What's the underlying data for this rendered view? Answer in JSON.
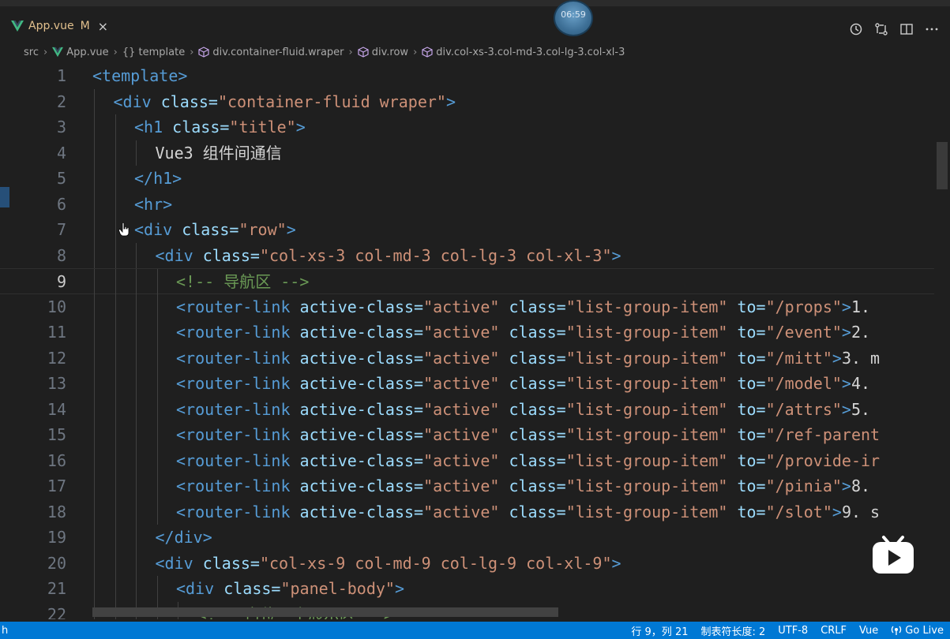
{
  "tab": {
    "filename": "App.vue",
    "modified": "M",
    "close": "×"
  },
  "timer_overlay": "06:59",
  "breadcrumbs": [
    {
      "label": "src"
    },
    {
      "label": "App.vue"
    },
    {
      "label": "{} template"
    },
    {
      "label": "div.container-fluid.wraper"
    },
    {
      "label": "div.row"
    },
    {
      "label": "div.col-xs-3.col-md-3.col-lg-3.col-xl-3"
    }
  ],
  "editor": {
    "current_line": 9,
    "lines": [
      {
        "n": "1",
        "indent": 0,
        "tokens": [
          [
            "tag",
            "<template>"
          ]
        ]
      },
      {
        "n": "2",
        "indent": 1,
        "tokens": [
          [
            "tag",
            "<div "
          ],
          [
            "attr",
            "class="
          ],
          [
            "str",
            "\"container-fluid wraper\""
          ],
          [
            "tag",
            ">"
          ]
        ]
      },
      {
        "n": "3",
        "indent": 2,
        "tokens": [
          [
            "tag",
            "<h1 "
          ],
          [
            "attr",
            "class="
          ],
          [
            "str",
            "\"title\""
          ],
          [
            "tag",
            ">"
          ]
        ]
      },
      {
        "n": "4",
        "indent": 3,
        "tokens": [
          [
            "text",
            "Vue3 组件间通信"
          ]
        ]
      },
      {
        "n": "5",
        "indent": 2,
        "tokens": [
          [
            "tag",
            "</h1>"
          ]
        ]
      },
      {
        "n": "6",
        "indent": 2,
        "tokens": [
          [
            "tag",
            "<hr>"
          ]
        ]
      },
      {
        "n": "7",
        "indent": 2,
        "tokens": [
          [
            "tag",
            "<div "
          ],
          [
            "attr",
            "class="
          ],
          [
            "str",
            "\"row\""
          ],
          [
            "tag",
            ">"
          ]
        ]
      },
      {
        "n": "8",
        "indent": 3,
        "tokens": [
          [
            "tag",
            "<div "
          ],
          [
            "attr",
            "class="
          ],
          [
            "str",
            "\"col-xs-3 col-md-3 col-lg-3 col-xl-3\""
          ],
          [
            "tag",
            ">"
          ]
        ]
      },
      {
        "n": "9",
        "indent": 4,
        "tokens": [
          [
            "com",
            "<!-- 导航区 -->"
          ]
        ]
      },
      {
        "n": "10",
        "indent": 4,
        "tokens": [
          [
            "tag",
            "<router-link "
          ],
          [
            "attr",
            "active-class="
          ],
          [
            "str",
            "\"active\" "
          ],
          [
            "attr",
            "class="
          ],
          [
            "str",
            "\"list-group-item\" "
          ],
          [
            "attr",
            "to="
          ],
          [
            "str",
            "\"/props\""
          ],
          [
            "tag",
            ">"
          ],
          [
            "text",
            "1."
          ]
        ]
      },
      {
        "n": "11",
        "indent": 4,
        "tokens": [
          [
            "tag",
            "<router-link "
          ],
          [
            "attr",
            "active-class="
          ],
          [
            "str",
            "\"active\" "
          ],
          [
            "attr",
            "class="
          ],
          [
            "str",
            "\"list-group-item\" "
          ],
          [
            "attr",
            "to="
          ],
          [
            "str",
            "\"/event\""
          ],
          [
            "tag",
            ">"
          ],
          [
            "text",
            "2."
          ]
        ]
      },
      {
        "n": "12",
        "indent": 4,
        "tokens": [
          [
            "tag",
            "<router-link "
          ],
          [
            "attr",
            "active-class="
          ],
          [
            "str",
            "\"active\" "
          ],
          [
            "attr",
            "class="
          ],
          [
            "str",
            "\"list-group-item\" "
          ],
          [
            "attr",
            "to="
          ],
          [
            "str",
            "\"/mitt\""
          ],
          [
            "tag",
            ">"
          ],
          [
            "text",
            "3. m"
          ]
        ]
      },
      {
        "n": "13",
        "indent": 4,
        "tokens": [
          [
            "tag",
            "<router-link "
          ],
          [
            "attr",
            "active-class="
          ],
          [
            "str",
            "\"active\" "
          ],
          [
            "attr",
            "class="
          ],
          [
            "str",
            "\"list-group-item\" "
          ],
          [
            "attr",
            "to="
          ],
          [
            "str",
            "\"/model\""
          ],
          [
            "tag",
            ">"
          ],
          [
            "text",
            "4."
          ]
        ]
      },
      {
        "n": "14",
        "indent": 4,
        "tokens": [
          [
            "tag",
            "<router-link "
          ],
          [
            "attr",
            "active-class="
          ],
          [
            "str",
            "\"active\" "
          ],
          [
            "attr",
            "class="
          ],
          [
            "str",
            "\"list-group-item\" "
          ],
          [
            "attr",
            "to="
          ],
          [
            "str",
            "\"/attrs\""
          ],
          [
            "tag",
            ">"
          ],
          [
            "text",
            "5."
          ]
        ]
      },
      {
        "n": "15",
        "indent": 4,
        "tokens": [
          [
            "tag",
            "<router-link "
          ],
          [
            "attr",
            "active-class="
          ],
          [
            "str",
            "\"active\" "
          ],
          [
            "attr",
            "class="
          ],
          [
            "str",
            "\"list-group-item\" "
          ],
          [
            "attr",
            "to="
          ],
          [
            "str",
            "\"/ref-parent"
          ]
        ]
      },
      {
        "n": "16",
        "indent": 4,
        "tokens": [
          [
            "tag",
            "<router-link "
          ],
          [
            "attr",
            "active-class="
          ],
          [
            "str",
            "\"active\" "
          ],
          [
            "attr",
            "class="
          ],
          [
            "str",
            "\"list-group-item\" "
          ],
          [
            "attr",
            "to="
          ],
          [
            "str",
            "\"/provide-ir"
          ]
        ]
      },
      {
        "n": "17",
        "indent": 4,
        "tokens": [
          [
            "tag",
            "<router-link "
          ],
          [
            "attr",
            "active-class="
          ],
          [
            "str",
            "\"active\" "
          ],
          [
            "attr",
            "class="
          ],
          [
            "str",
            "\"list-group-item\" "
          ],
          [
            "attr",
            "to="
          ],
          [
            "str",
            "\"/pinia\""
          ],
          [
            "tag",
            ">"
          ],
          [
            "text",
            "8."
          ]
        ]
      },
      {
        "n": "18",
        "indent": 4,
        "tokens": [
          [
            "tag",
            "<router-link "
          ],
          [
            "attr",
            "active-class="
          ],
          [
            "str",
            "\"active\" "
          ],
          [
            "attr",
            "class="
          ],
          [
            "str",
            "\"list-group-item\" "
          ],
          [
            "attr",
            "to="
          ],
          [
            "str",
            "\"/slot\""
          ],
          [
            "tag",
            ">"
          ],
          [
            "text",
            "9. s"
          ]
        ]
      },
      {
        "n": "19",
        "indent": 3,
        "tokens": [
          [
            "tag",
            "</div>"
          ]
        ]
      },
      {
        "n": "20",
        "indent": 3,
        "tokens": [
          [
            "tag",
            "<div "
          ],
          [
            "attr",
            "class="
          ],
          [
            "str",
            "\"col-xs-9 col-md-9 col-lg-9 col-xl-9\""
          ],
          [
            "tag",
            ">"
          ]
        ]
      },
      {
        "n": "21",
        "indent": 4,
        "tokens": [
          [
            "tag",
            "<div "
          ],
          [
            "attr",
            "class="
          ],
          [
            "str",
            "\"panel-body\""
          ],
          [
            "tag",
            ">"
          ]
        ]
      },
      {
        "n": "22",
        "indent": 5,
        "tokens": [
          [
            "com",
            "<!-- 占位一个展示区 -->"
          ]
        ]
      }
    ]
  },
  "statusbar": {
    "left": "h",
    "cursor": "行 9，列 21",
    "tab_size": "制表符长度: 2",
    "encoding": "UTF-8",
    "eol": "CRLF",
    "language": "Vue",
    "golive": "Go Live"
  },
  "colors": {
    "statusbar": "#0078d4",
    "background": "#1f1f1f",
    "tag": "#569cd6",
    "attr": "#9cdcfe",
    "string": "#ce9178",
    "comment": "#6a9955"
  }
}
